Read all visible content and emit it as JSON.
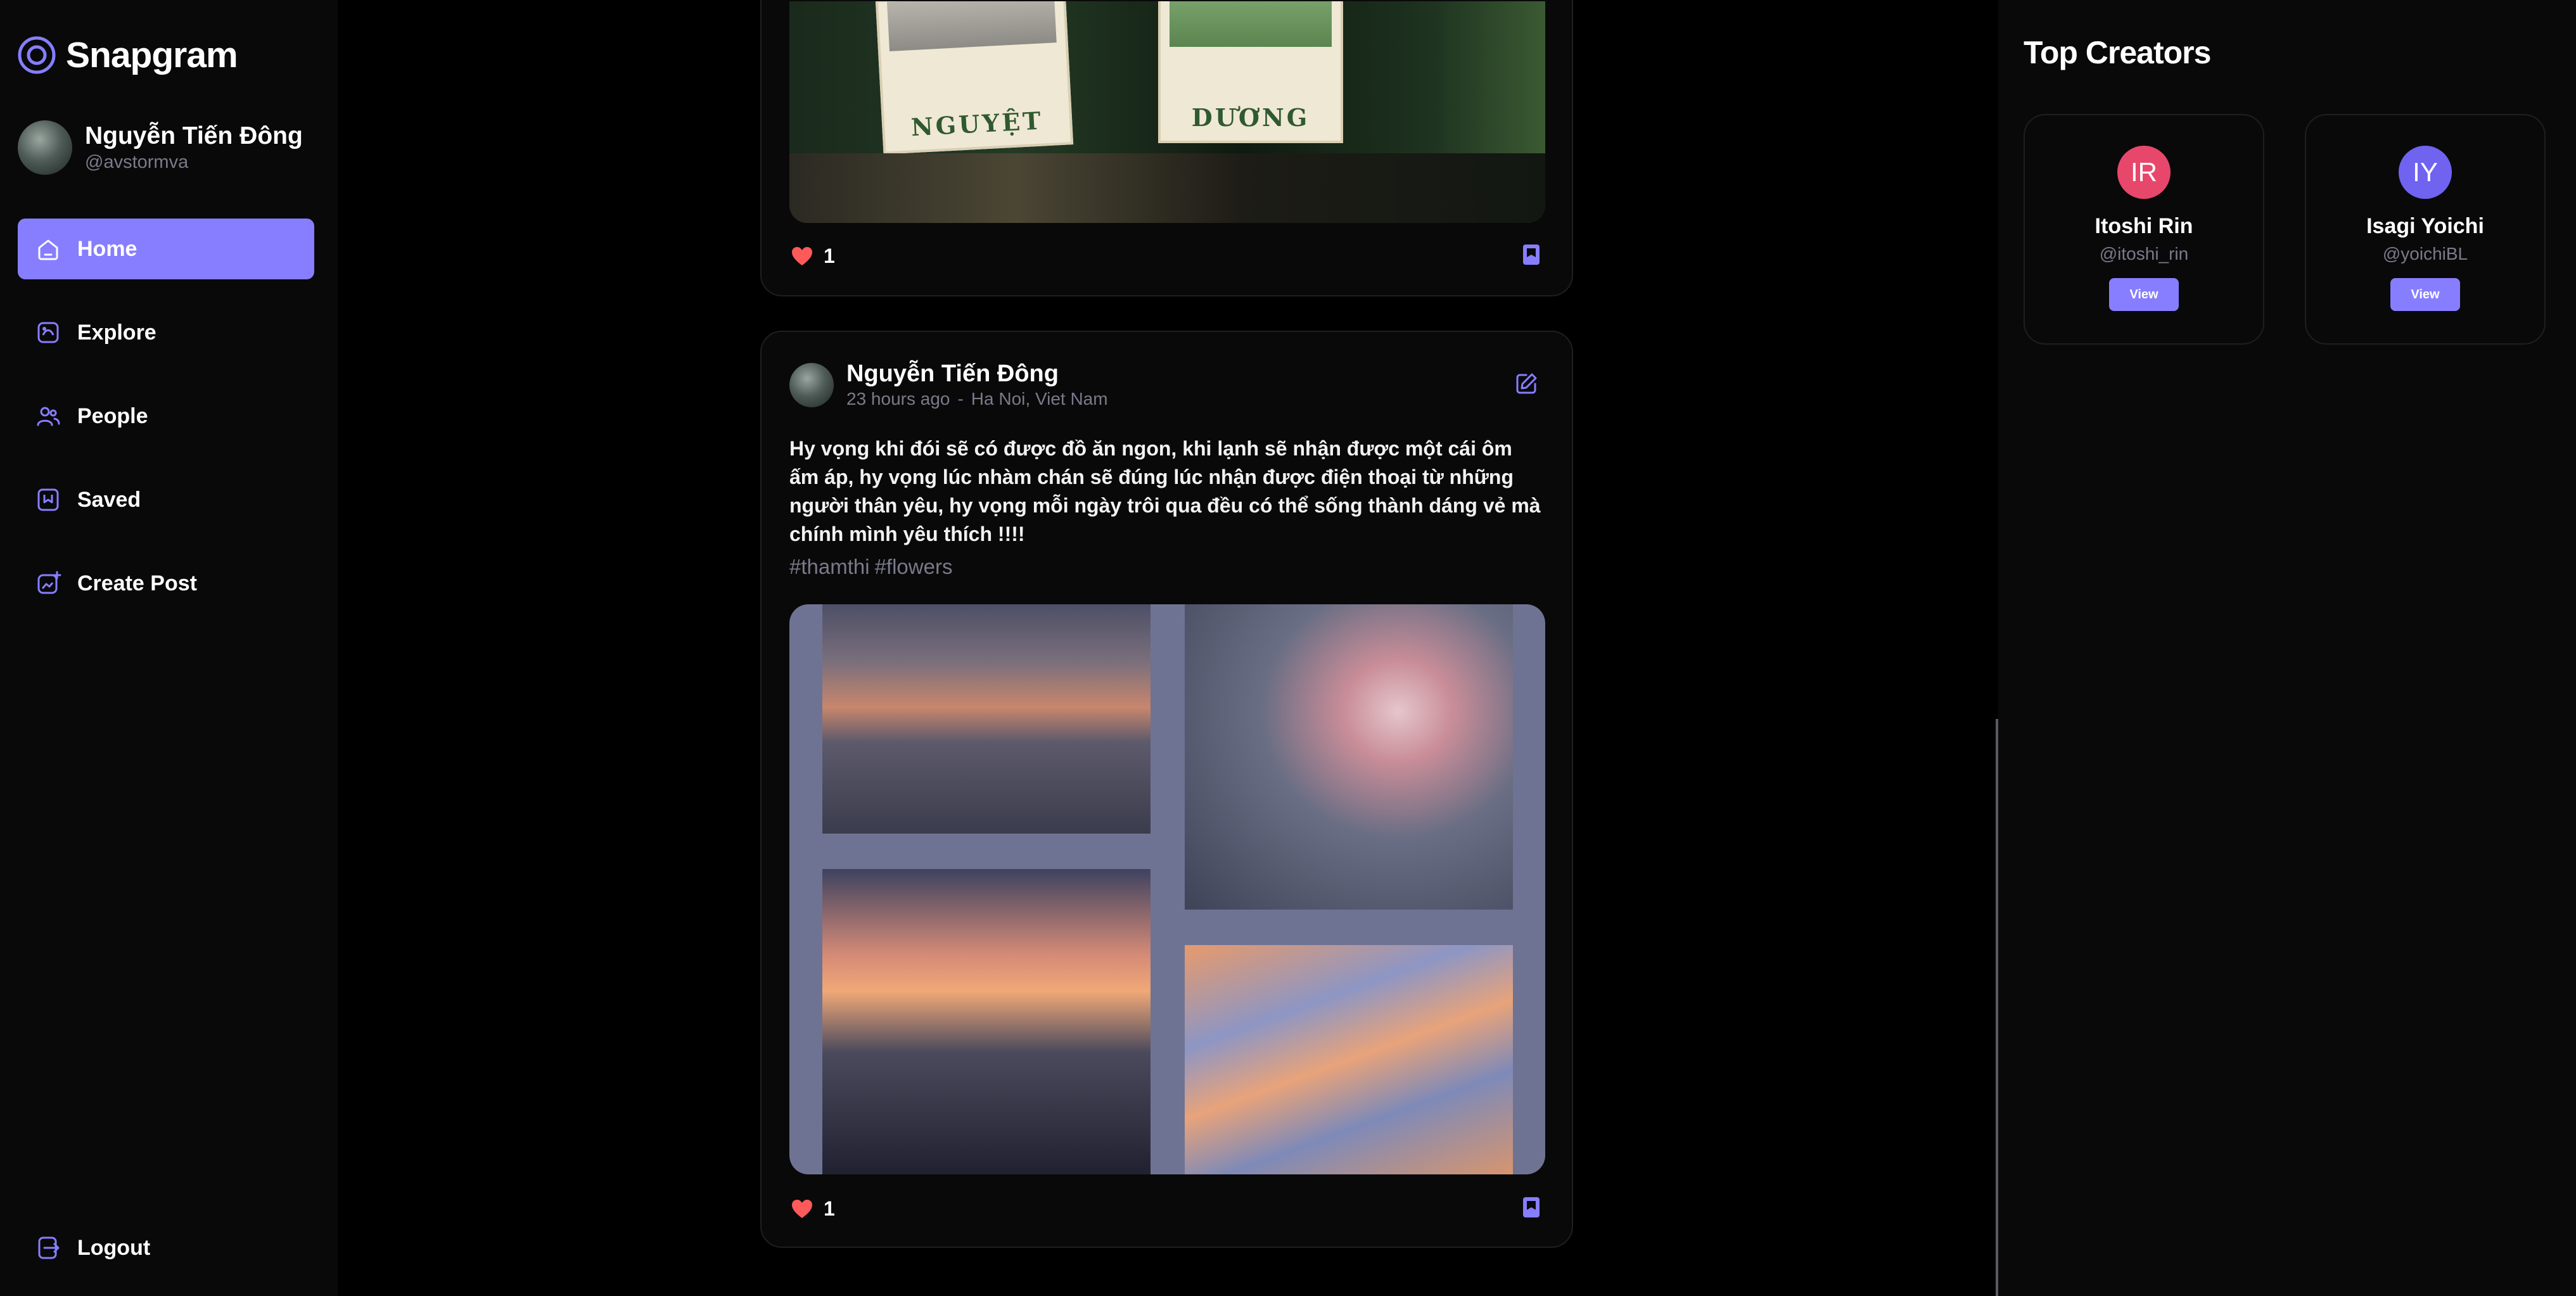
{
  "app": {
    "name": "Snapgram"
  },
  "profile": {
    "name": "Nguyễn Tiến Đông",
    "handle": "@avstormva"
  },
  "nav": {
    "items": [
      {
        "label": "Home",
        "icon": "home-icon",
        "active": true
      },
      {
        "label": "Explore",
        "icon": "explore-icon",
        "active": false
      },
      {
        "label": "People",
        "icon": "people-icon",
        "active": false
      },
      {
        "label": "Saved",
        "icon": "saved-icon",
        "active": false
      },
      {
        "label": "Create Post",
        "icon": "create-post-icon",
        "active": false
      }
    ],
    "logout_label": "Logout"
  },
  "feed": {
    "post1": {
      "poster_left": "NGUYỆT",
      "poster_right": "DƯƠNG",
      "likes": "1"
    },
    "post2": {
      "author": "Nguyễn Tiến Đông",
      "time": "23 hours ago",
      "location": "Ha Noi, Viet Nam",
      "caption": "Hy vọng khi đói sẽ có được đồ ăn ngon, khi lạnh sẽ nhận được một cái ôm ấm áp, hy vọng lúc nhàm chán sẽ đúng lúc nhận được điện thoại từ những người thân yêu, hy vọng mỗi ngày trôi qua đều có thể sống thành dáng vẻ mà chính mình yêu thích !!!!",
      "tags": [
        "#thamthi",
        "#flowers"
      ],
      "likes": "1"
    }
  },
  "top_creators": {
    "title": "Top Creators",
    "creators": [
      {
        "initials": "IR",
        "name": "Itoshi Rin",
        "handle": "@itoshi_rin",
        "button": "View",
        "color": "#e8476c"
      },
      {
        "initials": "IY",
        "name": "Isagi Yoichi",
        "handle": "@yoichiBL",
        "button": "View",
        "color": "#6f63f0"
      }
    ]
  },
  "colors": {
    "accent": "#877eff",
    "like": "#ff5a5a",
    "background": "#000000",
    "panel": "#09090a"
  }
}
